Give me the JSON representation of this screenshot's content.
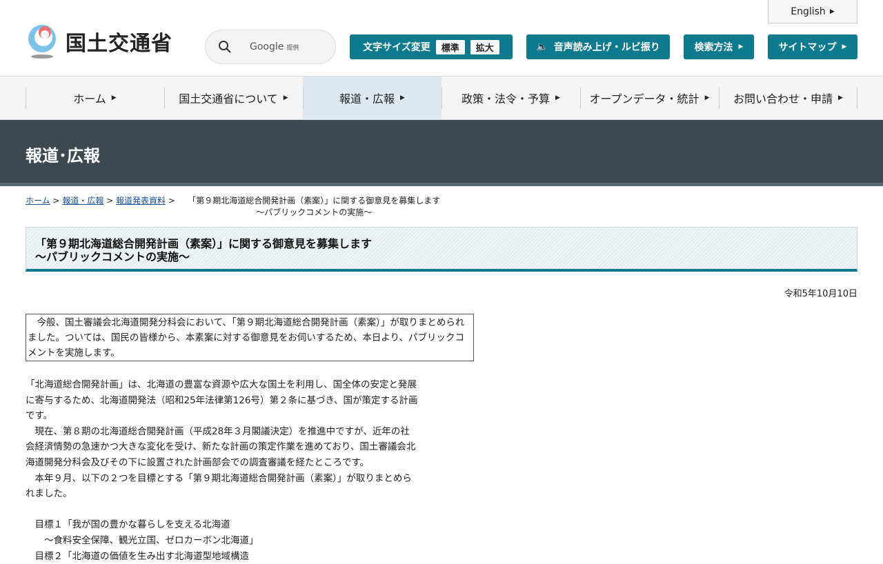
{
  "header": {
    "english": "English",
    "logo_text": "国土交通省",
    "search_provider": "Google",
    "search_suffix": "提供",
    "font_size_label": "文字サイズ変更",
    "font_standard": "標準",
    "font_large": "拡大",
    "speech": "音声読み上げ・ルビ振り",
    "search_method": "検索方法",
    "sitemap": "サイトマップ"
  },
  "nav": [
    "ホーム",
    "国土交通省について",
    "報道・広報",
    "政策・法令・予算",
    "オープンデータ・統計",
    "お問い合わせ・申請"
  ],
  "banner": "報道･広報",
  "breadcrumb": {
    "home": "ホーム",
    "press": "報道・広報",
    "releases": "報道発表資料",
    "current_line1": "「第９期北海道総合開発計画（素案）」に関する御意見を募集します",
    "current_line2": "～パブリックコメントの実施～"
  },
  "title": {
    "line1": "「第９期北海道総合開発計画（素案）」に関する御意見を募集します",
    "line2": "～パブリックコメントの実施～"
  },
  "date": "令和5年10月10日",
  "summary": "今般、国土審議会北海道開発分科会において、「第９期北海道総合開発計画（素案）」が取りまとめられました。ついては、国民の皆様から、本素案に対する御意見をお伺いするため、本日より、パブリックコメントを実施します。",
  "body": [
    "「北海道総合開発計画」は、北海道の豊富な資源や広大な国土を利用し、国全体の安定と発展に寄与するため、北海道開発法（昭和25年法律第126号）第２条に基づき、国が策定する計画です。",
    "　現在、第８期の北海道総合開発計画（平成28年３月閣議決定）を推進中ですが、近年の社会経済情勢の急速かつ大きな変化を受け、新たな計画の策定作業を進めており、国土審議会北海道開発分科会及びその下に設置された計画部会での調査審議を経たところです。",
    "　本年９月、以下の２つを目標とする「第９期北海道総合開発計画（素案）」が取りまとめられました。",
    "",
    "　目標１「我が国の豊かな暮らしを支える北海道",
    "　　～食料安全保障、観光立国、ゼロカーボン北海道」",
    "　目標２「北海道の価値を生み出す北海道型地域構造"
  ]
}
